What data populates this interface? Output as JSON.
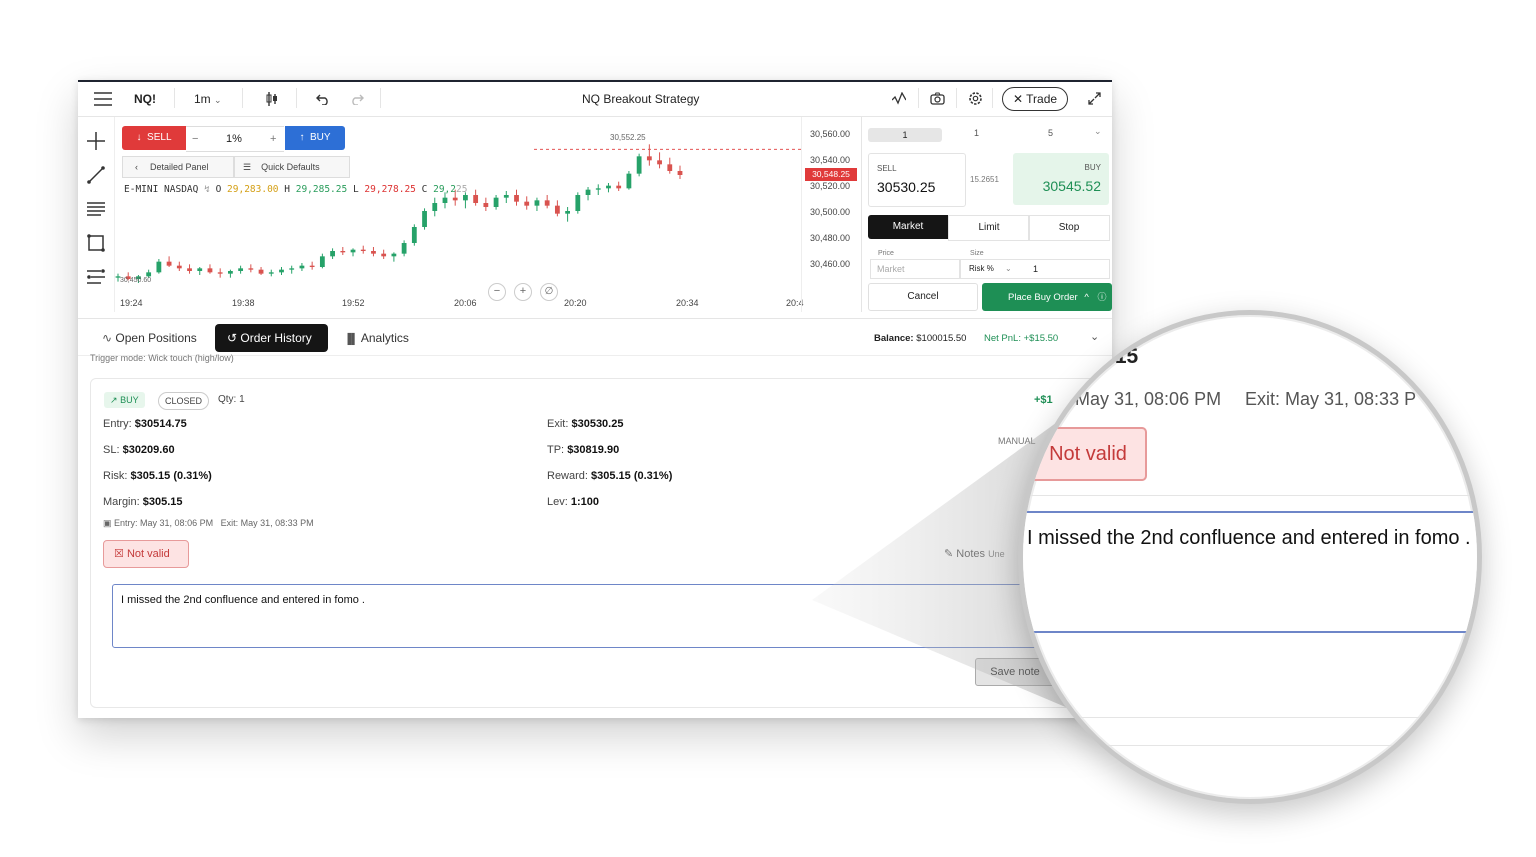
{
  "topbar": {
    "symbol": "NQ!",
    "interval": "1m",
    "title": "NQ Breakout Strategy",
    "trade_label": "Trade"
  },
  "order_widget": {
    "sell_label": "SELL",
    "percent": "1%",
    "buy_label": "BUY",
    "detailed_panel": "Detailed Panel",
    "quick_defaults": "Quick Defaults"
  },
  "ohlc": {
    "name": "E-MINI NASDAQ",
    "o_label": "O",
    "o": "29,283.00",
    "h_label": "H",
    "h": "29,285.25",
    "l_label": "L",
    "l": "29,278.25",
    "c_label": "C",
    "c": "29,2",
    "c_tail": "25"
  },
  "chart_data": {
    "type": "candlestick",
    "x_ticks": [
      "19:24",
      "19:38",
      "19:52",
      "20:06",
      "20:20",
      "20:34",
      "20:4"
    ],
    "y_ticks": [
      "30,560.00",
      "30,540.00",
      "30,520.00",
      "30,500.00",
      "30,480.00",
      "30,460.00"
    ],
    "high_label": "30,552.25",
    "low_label": "30,450.60",
    "current_price": "30,548.25",
    "candles": [
      [
        30452,
        30455,
        30449,
        30453
      ],
      [
        30453,
        30456,
        30450,
        30451
      ],
      [
        30451,
        30454,
        30448,
        30453
      ],
      [
        30453,
        30458,
        30452,
        30456
      ],
      [
        30456,
        30466,
        30455,
        30464
      ],
      [
        30464,
        30468,
        30460,
        30461
      ],
      [
        30461,
        30464,
        30457,
        30459
      ],
      [
        30459,
        30462,
        30455,
        30457
      ],
      [
        30457,
        30460,
        30454,
        30459
      ],
      [
        30459,
        30462,
        30455,
        30456
      ],
      [
        30456,
        30459,
        30452,
        30455
      ],
      [
        30455,
        30458,
        30452,
        30457
      ],
      [
        30457,
        30461,
        30455,
        30459
      ],
      [
        30459,
        30462,
        30456,
        30458
      ],
      [
        30458,
        30460,
        30454,
        30455
      ],
      [
        30455,
        30458,
        30453,
        30456
      ],
      [
        30456,
        30460,
        30454,
        30458
      ],
      [
        30458,
        30461,
        30455,
        30459
      ],
      [
        30459,
        30463,
        30457,
        30461
      ],
      [
        30461,
        30464,
        30458,
        30460
      ],
      [
        30460,
        30470,
        30459,
        30468
      ],
      [
        30468,
        30474,
        30466,
        30472
      ],
      [
        30472,
        30475,
        30469,
        30471
      ],
      [
        30471,
        30474,
        30468,
        30473
      ],
      [
        30473,
        30476,
        30470,
        30472
      ],
      [
        30472,
        30475,
        30468,
        30470
      ],
      [
        30470,
        30473,
        30466,
        30468
      ],
      [
        30468,
        30471,
        30464,
        30470
      ],
      [
        30470,
        30480,
        30468,
        30478
      ],
      [
        30478,
        30492,
        30476,
        30490
      ],
      [
        30490,
        30504,
        30488,
        30502
      ],
      [
        30502,
        30512,
        30498,
        30508
      ],
      [
        30508,
        30516,
        30504,
        30512
      ],
      [
        30512,
        30518,
        30506,
        30510
      ],
      [
        30510,
        30516,
        30504,
        30514
      ],
      [
        30514,
        30518,
        30506,
        30508
      ],
      [
        30508,
        30512,
        30502,
        30505
      ],
      [
        30505,
        30514,
        30503,
        30512
      ],
      [
        30512,
        30517,
        30508,
        30514
      ],
      [
        30514,
        30518,
        30506,
        30509
      ],
      [
        30509,
        30513,
        30503,
        30506
      ],
      [
        30506,
        30512,
        30502,
        30510
      ],
      [
        30510,
        30514,
        30504,
        30506
      ],
      [
        30506,
        30510,
        30498,
        30500
      ],
      [
        30500,
        30505,
        30494,
        30502
      ],
      [
        30502,
        30516,
        30500,
        30514
      ],
      [
        30514,
        30520,
        30510,
        30518
      ],
      [
        30518,
        30522,
        30514,
        30519
      ],
      [
        30519,
        30523,
        30516,
        30521
      ],
      [
        30521,
        30524,
        30517,
        30519
      ],
      [
        30519,
        30532,
        30518,
        30530
      ],
      [
        30530,
        30545,
        30528,
        30543
      ],
      [
        30543,
        30552,
        30536,
        30540
      ],
      [
        30540,
        30546,
        30534,
        30537
      ],
      [
        30537,
        30542,
        30530,
        30532
      ],
      [
        30532,
        30536,
        30526,
        30529
      ]
    ]
  },
  "price_panel": {
    "qty_tabs": [
      "1",
      "1",
      "5"
    ],
    "sell_label": "SELL",
    "sell_price": "30530.25",
    "spread": "15.2651",
    "buy_label": "BUY",
    "buy_price": "30545.52",
    "order_types": [
      "Market",
      "Limit",
      "Stop"
    ],
    "price_label": "Price",
    "price_value": "Market",
    "size_label": "Size",
    "size_mode": "Risk %",
    "size_value": "1",
    "cancel_label": "Cancel",
    "place_label": "Place Buy Order"
  },
  "tabs": {
    "open_positions": "Open Positions",
    "order_history": "Order History",
    "analytics": "Analytics",
    "balance_label": "Balance:",
    "balance_value": "$100015.50",
    "net_pnl_label": "Net PnL:",
    "net_pnl_value": "+$15.50"
  },
  "trigger_mode": "Trigger mode: Wick touch (high/low)",
  "trade": {
    "side": "BUY",
    "status": "CLOSED",
    "qty_label": "Qty:",
    "qty": "1",
    "entry_label": "Entry:",
    "entry": "$30514.75",
    "exit_label": "Exit:",
    "exit": "$30530.25",
    "sl_label": "SL:",
    "sl": "$30209.60",
    "tp_label": "TP:",
    "tp": "$30819.90",
    "risk_label": "Risk:",
    "risk": "$305.15 (0.31%)",
    "reward_label": "Reward:",
    "reward": "$305.15 (0.31%)",
    "margin_label": "Margin:",
    "margin": "$305.15",
    "lev_label": "Lev:",
    "lev": "1:100",
    "entry_time": "Entry: May 31, 08:06 PM",
    "exit_time": "Exit: May 31, 08:33 PM",
    "pnl": "+$1",
    "manual": "MANUAL",
    "validity": "Not valid",
    "notes_label": "Notes",
    "notes_status": "Une",
    "note_text": "I missed the 2nd confluence and entered in fomo .",
    "save_label": "Save note"
  },
  "magnifier": {
    "top_value": ".15",
    "pnl_fragment": "+$1",
    "entry_time": "May 31, 08:06 PM",
    "exit_time": "Exit: May 31, 08:33 P",
    "validity": "Not valid",
    "note_text": "I missed the 2nd confluence and entered in fomo ."
  },
  "colors": {
    "sell": "#e03a3a",
    "buy_blue": "#2d6fd6",
    "buy_green": "#1e8f55",
    "up_candle": "#26a269",
    "down_candle": "#d9534f",
    "dark_tab": "#151515"
  }
}
